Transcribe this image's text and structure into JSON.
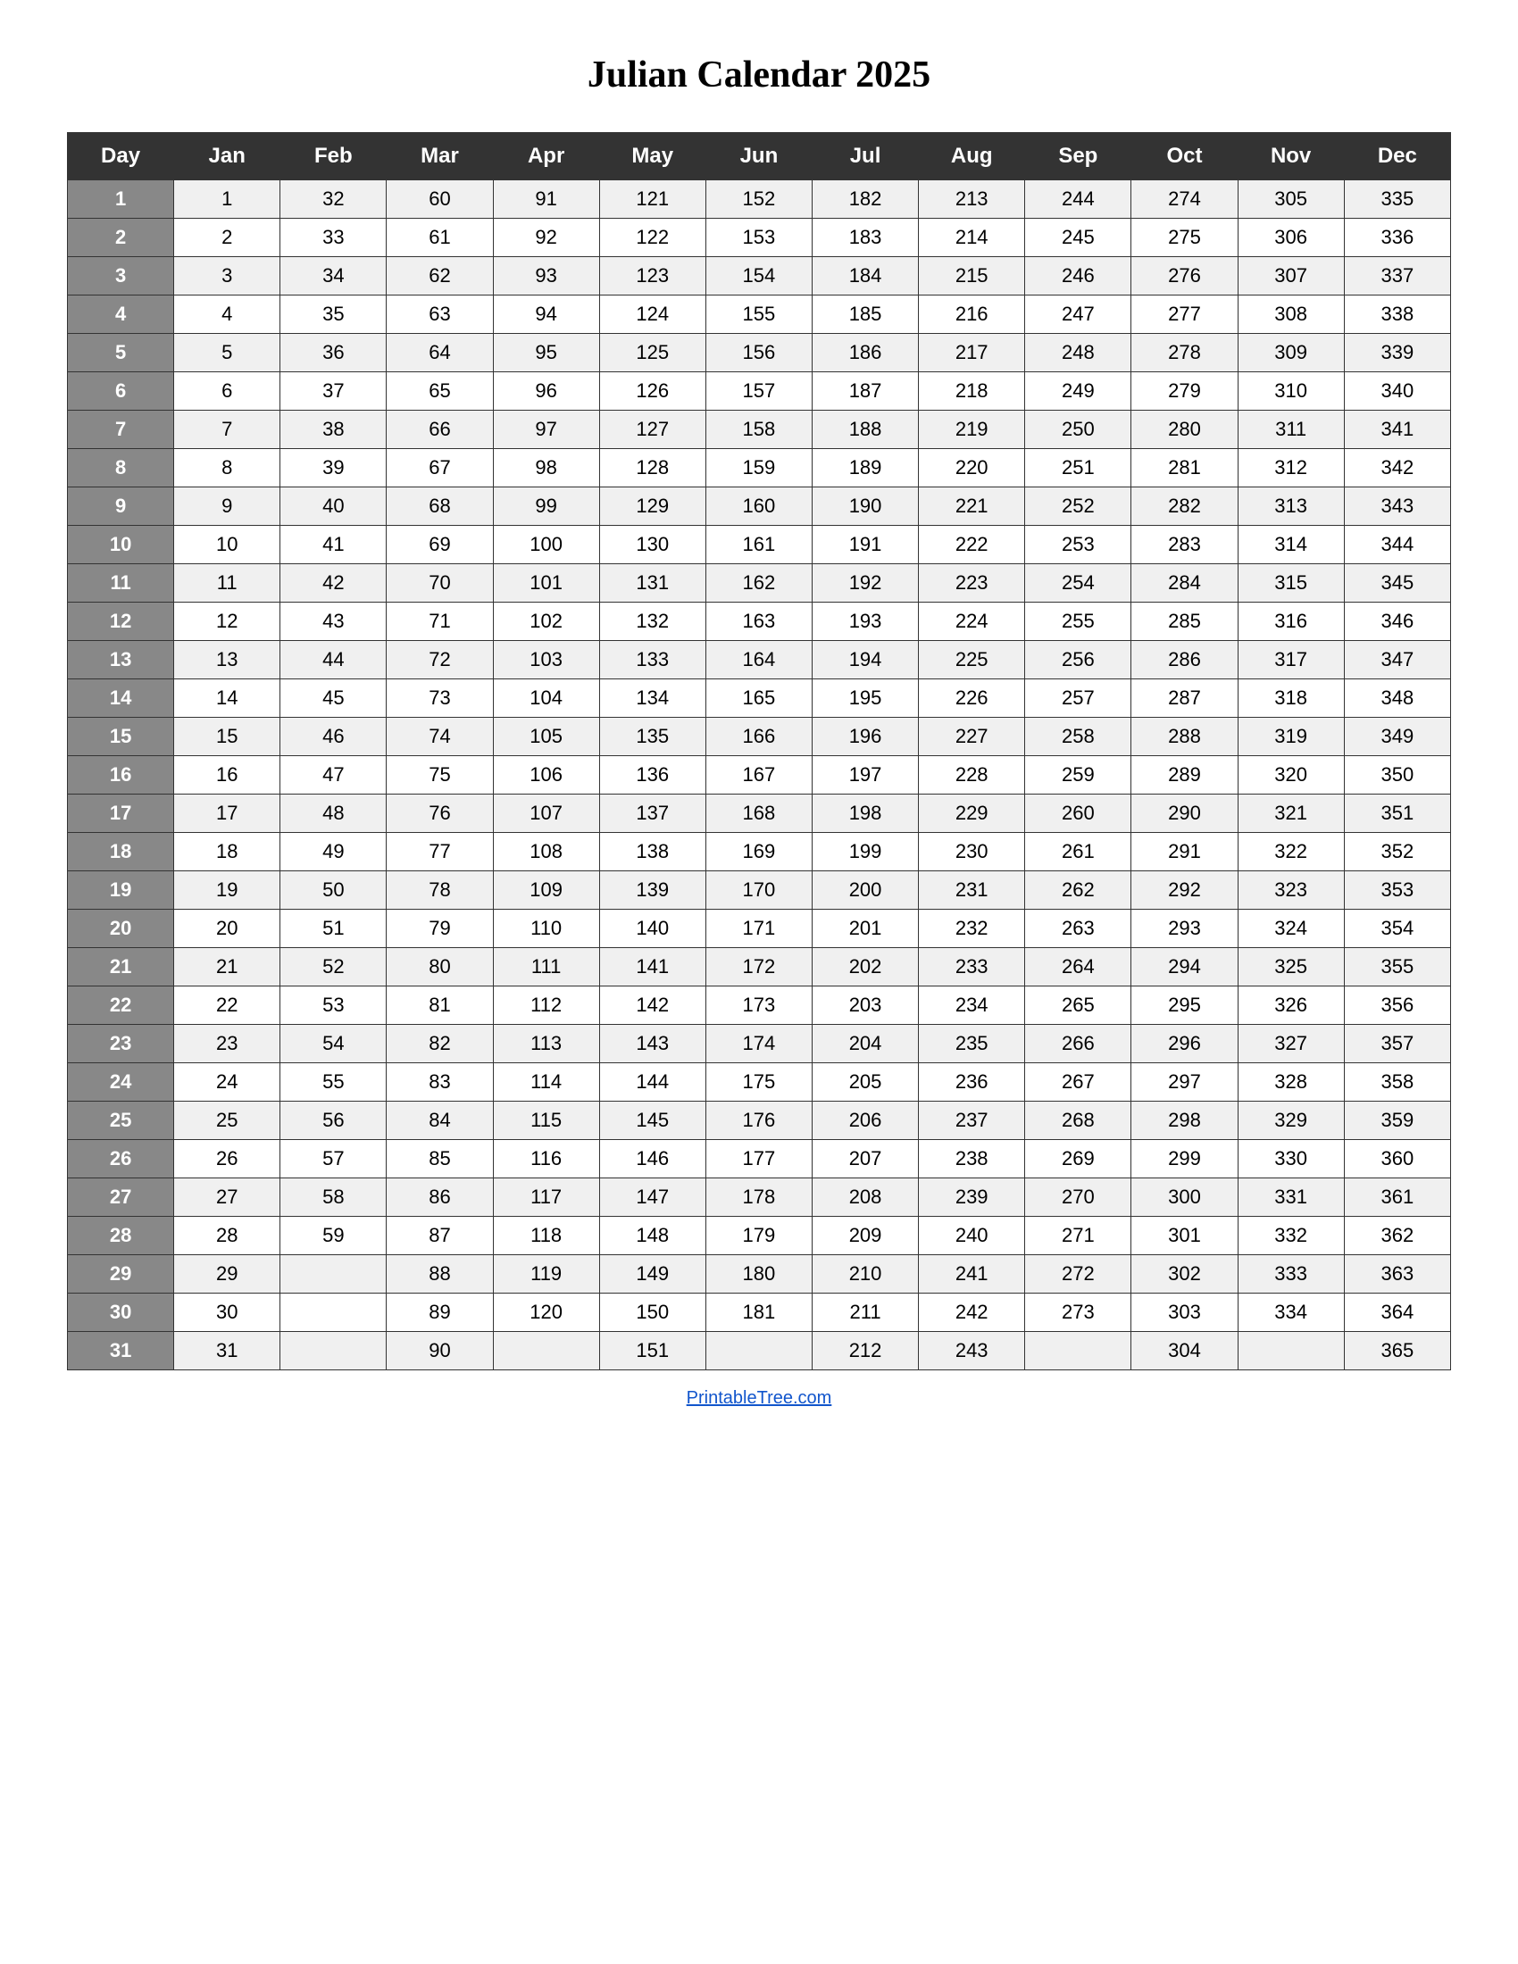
{
  "title": "Julian Calendar 2025",
  "headers": [
    "Day",
    "Jan",
    "Feb",
    "Mar",
    "Apr",
    "May",
    "Jun",
    "Jul",
    "Aug",
    "Sep",
    "Oct",
    "Nov",
    "Dec"
  ],
  "rows": [
    [
      1,
      1,
      32,
      60,
      91,
      121,
      152,
      182,
      213,
      244,
      274,
      305,
      335
    ],
    [
      2,
      2,
      33,
      61,
      92,
      122,
      153,
      183,
      214,
      245,
      275,
      306,
      336
    ],
    [
      3,
      3,
      34,
      62,
      93,
      123,
      154,
      184,
      215,
      246,
      276,
      307,
      337
    ],
    [
      4,
      4,
      35,
      63,
      94,
      124,
      155,
      185,
      216,
      247,
      277,
      308,
      338
    ],
    [
      5,
      5,
      36,
      64,
      95,
      125,
      156,
      186,
      217,
      248,
      278,
      309,
      339
    ],
    [
      6,
      6,
      37,
      65,
      96,
      126,
      157,
      187,
      218,
      249,
      279,
      310,
      340
    ],
    [
      7,
      7,
      38,
      66,
      97,
      127,
      158,
      188,
      219,
      250,
      280,
      311,
      341
    ],
    [
      8,
      8,
      39,
      67,
      98,
      128,
      159,
      189,
      220,
      251,
      281,
      312,
      342
    ],
    [
      9,
      9,
      40,
      68,
      99,
      129,
      160,
      190,
      221,
      252,
      282,
      313,
      343
    ],
    [
      10,
      10,
      41,
      69,
      100,
      130,
      161,
      191,
      222,
      253,
      283,
      314,
      344
    ],
    [
      11,
      11,
      42,
      70,
      101,
      131,
      162,
      192,
      223,
      254,
      284,
      315,
      345
    ],
    [
      12,
      12,
      43,
      71,
      102,
      132,
      163,
      193,
      224,
      255,
      285,
      316,
      346
    ],
    [
      13,
      13,
      44,
      72,
      103,
      133,
      164,
      194,
      225,
      256,
      286,
      317,
      347
    ],
    [
      14,
      14,
      45,
      73,
      104,
      134,
      165,
      195,
      226,
      257,
      287,
      318,
      348
    ],
    [
      15,
      15,
      46,
      74,
      105,
      135,
      166,
      196,
      227,
      258,
      288,
      319,
      349
    ],
    [
      16,
      16,
      47,
      75,
      106,
      136,
      167,
      197,
      228,
      259,
      289,
      320,
      350
    ],
    [
      17,
      17,
      48,
      76,
      107,
      137,
      168,
      198,
      229,
      260,
      290,
      321,
      351
    ],
    [
      18,
      18,
      49,
      77,
      108,
      138,
      169,
      199,
      230,
      261,
      291,
      322,
      352
    ],
    [
      19,
      19,
      50,
      78,
      109,
      139,
      170,
      200,
      231,
      262,
      292,
      323,
      353
    ],
    [
      20,
      20,
      51,
      79,
      110,
      140,
      171,
      201,
      232,
      263,
      293,
      324,
      354
    ],
    [
      21,
      21,
      52,
      80,
      111,
      141,
      172,
      202,
      233,
      264,
      294,
      325,
      355
    ],
    [
      22,
      22,
      53,
      81,
      112,
      142,
      173,
      203,
      234,
      265,
      295,
      326,
      356
    ],
    [
      23,
      23,
      54,
      82,
      113,
      143,
      174,
      204,
      235,
      266,
      296,
      327,
      357
    ],
    [
      24,
      24,
      55,
      83,
      114,
      144,
      175,
      205,
      236,
      267,
      297,
      328,
      358
    ],
    [
      25,
      25,
      56,
      84,
      115,
      145,
      176,
      206,
      237,
      268,
      298,
      329,
      359
    ],
    [
      26,
      26,
      57,
      85,
      116,
      146,
      177,
      207,
      238,
      269,
      299,
      330,
      360
    ],
    [
      27,
      27,
      58,
      86,
      117,
      147,
      178,
      208,
      239,
      270,
      300,
      331,
      361
    ],
    [
      28,
      28,
      59,
      87,
      118,
      148,
      179,
      209,
      240,
      271,
      301,
      332,
      362
    ],
    [
      29,
      29,
      "",
      88,
      119,
      149,
      180,
      210,
      241,
      272,
      302,
      333,
      363
    ],
    [
      30,
      30,
      "",
      89,
      120,
      150,
      181,
      211,
      242,
      273,
      303,
      334,
      364
    ],
    [
      31,
      31,
      "",
      90,
      "",
      151,
      "",
      212,
      243,
      "",
      304,
      "",
      365
    ]
  ],
  "footer_text": "PrintableTree.com"
}
